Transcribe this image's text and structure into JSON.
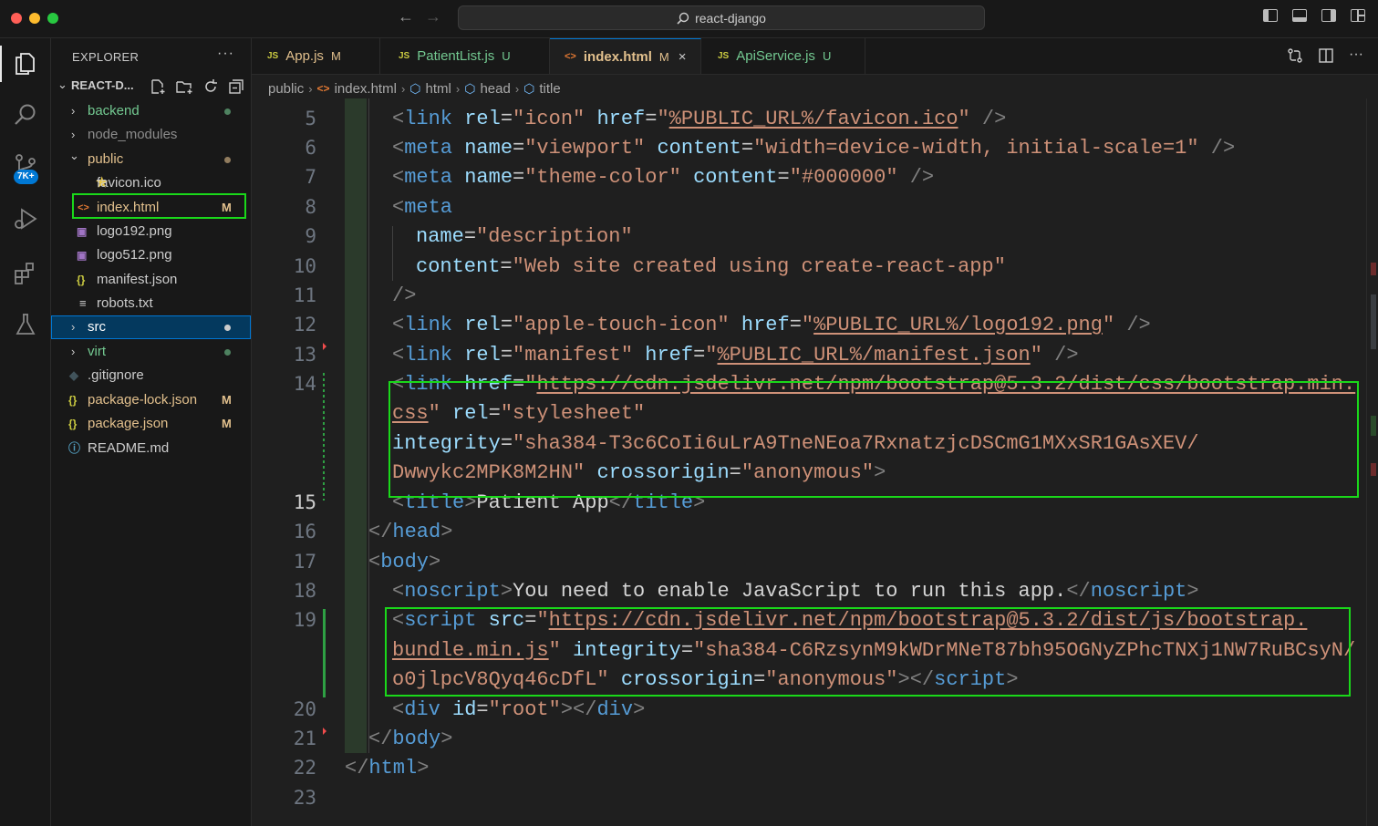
{
  "window": {
    "search_text": "react-django"
  },
  "activity": {
    "items": [
      "explorer",
      "search",
      "source-control",
      "run-debug",
      "extensions",
      "testing"
    ],
    "scm_badge": "7K+"
  },
  "sidebar": {
    "header": "EXPLORER",
    "more": "···",
    "section_title": "REACT-D...",
    "rows": [
      {
        "label": "backend",
        "icon": "chevron-right",
        "status": "dot",
        "color": "#73c991"
      },
      {
        "label": "node_modules",
        "icon": "chevron-right",
        "color": "#8c8c8c"
      },
      {
        "label": "public",
        "icon": "chevron-down",
        "status": "dot",
        "color": "#e2c08d"
      },
      {
        "label": "favicon.ico",
        "icon": "star-icon",
        "color": "#cccccc"
      },
      {
        "label": "index.html",
        "icon": "html-icon",
        "mark": "M",
        "color": "#e2c08d"
      },
      {
        "label": "logo192.png",
        "icon": "image-icon",
        "color": "#cccccc"
      },
      {
        "label": "logo512.png",
        "icon": "image-icon",
        "color": "#cccccc"
      },
      {
        "label": "manifest.json",
        "icon": "json-icon",
        "color": "#cccccc"
      },
      {
        "label": "robots.txt",
        "icon": "text-icon",
        "color": "#cccccc"
      },
      {
        "label": "src",
        "icon": "chevron-right",
        "status": "dot",
        "color": "#ffffff"
      },
      {
        "label": "virt",
        "icon": "chevron-right",
        "status": "dot",
        "color": "#73c991"
      },
      {
        "label": ".gitignore",
        "icon": "gitignore-icon",
        "color": "#cccccc"
      },
      {
        "label": "package-lock.json",
        "icon": "json-icon",
        "mark": "M",
        "color": "#e2c08d"
      },
      {
        "label": "package.json",
        "icon": "json-icon",
        "mark": "M",
        "color": "#e2c08d"
      },
      {
        "label": "README.md",
        "icon": "info-icon",
        "color": "#cccccc"
      }
    ]
  },
  "tabs": [
    {
      "label": "App.js",
      "icon": "JS",
      "mark": "M"
    },
    {
      "label": "PatientList.js",
      "icon": "JS",
      "mark": "U"
    },
    {
      "label": "index.html",
      "icon": "<>",
      "mark": "M",
      "active": true,
      "close": "×"
    },
    {
      "label": "ApiService.js",
      "icon": "JS",
      "mark": "U"
    }
  ],
  "breadcrumb": [
    "public",
    "index.html",
    "html",
    "head",
    "title"
  ],
  "editor": {
    "line_numbers": [
      "5",
      "6",
      "7",
      "8",
      "9",
      "10",
      "11",
      "12",
      "13",
      "14",
      "15",
      "16",
      "17",
      "18",
      "19",
      "20",
      "21",
      "22",
      "23"
    ],
    "current_line": "15",
    "code": {
      "l5": [
        "<",
        "link",
        " ",
        "rel",
        "=",
        "\"icon\"",
        " ",
        "href",
        "=",
        "\"",
        "%PUBLIC_URL%/favicon.ico",
        "\"",
        " />"
      ],
      "l6": [
        "<",
        "meta",
        " ",
        "name",
        "=",
        "\"viewport\"",
        " ",
        "content",
        "=",
        "\"width=device-width, initial-scale=1\"",
        " />"
      ],
      "l7": [
        "<",
        "meta",
        " ",
        "name",
        "=",
        "\"theme-color\"",
        " ",
        "content",
        "=",
        "\"#000000\"",
        " />"
      ],
      "l8": [
        "<",
        "meta"
      ],
      "l9": [
        "name",
        "=",
        "\"description\""
      ],
      "l10": [
        "content",
        "=",
        "\"Web site created using create-react-app\""
      ],
      "l11": [
        "/>"
      ],
      "l12": [
        "<",
        "link",
        " ",
        "rel",
        "=",
        "\"apple-touch-icon\"",
        " ",
        "href",
        "=",
        "\"",
        "%PUBLIC_URL%/logo192.png",
        "\"",
        " />"
      ],
      "l13": [
        "<",
        "link",
        " ",
        "rel",
        "=",
        "\"manifest\"",
        " ",
        "href",
        "=",
        "\"",
        "%PUBLIC_URL%/manifest.json",
        "\"",
        " />"
      ],
      "l14a": [
        "<",
        "link",
        " ",
        "href",
        "=",
        "\"",
        "https://cdn.jsdelivr.net/npm/bootstrap@5.3.2/dist/css/bootstrap.min."
      ],
      "l14b": [
        "css",
        "\"",
        " ",
        "rel",
        "=",
        "\"stylesheet\""
      ],
      "l14c": [
        "integrity",
        "=",
        "\"sha384-T3c6CoIi6uLrA9TneNEoa7RxnatzjcDSCmG1MXxSR1GAsXEV/"
      ],
      "l14d": [
        "Dwwykc2MPK8M2HN\"",
        " ",
        "crossorigin",
        "=",
        "\"anonymous\"",
        ">"
      ],
      "l15": [
        "<",
        "title",
        ">",
        "Patient App",
        "</",
        "title",
        ">"
      ],
      "l16": [
        "</",
        "head",
        ">"
      ],
      "l17": [
        "<",
        "body",
        ">"
      ],
      "l18": [
        "<",
        "noscript",
        ">",
        "You need to enable JavaScript to run this app.",
        "</",
        "noscript",
        ">"
      ],
      "l19a": [
        "<",
        "script",
        " ",
        "src",
        "=",
        "\"",
        "https://cdn.jsdelivr.net/npm/bootstrap@5.3.2/dist/js/bootstrap."
      ],
      "l19b": [
        "bundle.min.js",
        "\"",
        " ",
        "integrity",
        "=",
        "\"sha384-C6RzsynM9kWDrMNeT87bh95OGNyZPhcTNXj1NW7RuBCsyN/"
      ],
      "l19c": [
        "o0jlpcV8Qyq46cDfL\"",
        " ",
        "crossorigin",
        "=",
        "\"anonymous\"",
        "></",
        "script",
        ">"
      ],
      "l20": [
        "<",
        "div",
        " ",
        "id",
        "=",
        "\"root\"",
        "></",
        "div",
        ">"
      ],
      "l21": [
        "</",
        "body",
        ">"
      ],
      "l22": [
        "</",
        "html",
        ">"
      ]
    }
  },
  "colors": {
    "highlight_box": "#1ad81a",
    "accent": "#0078d4",
    "modified": "#e2c08d",
    "untracked": "#73c991"
  }
}
